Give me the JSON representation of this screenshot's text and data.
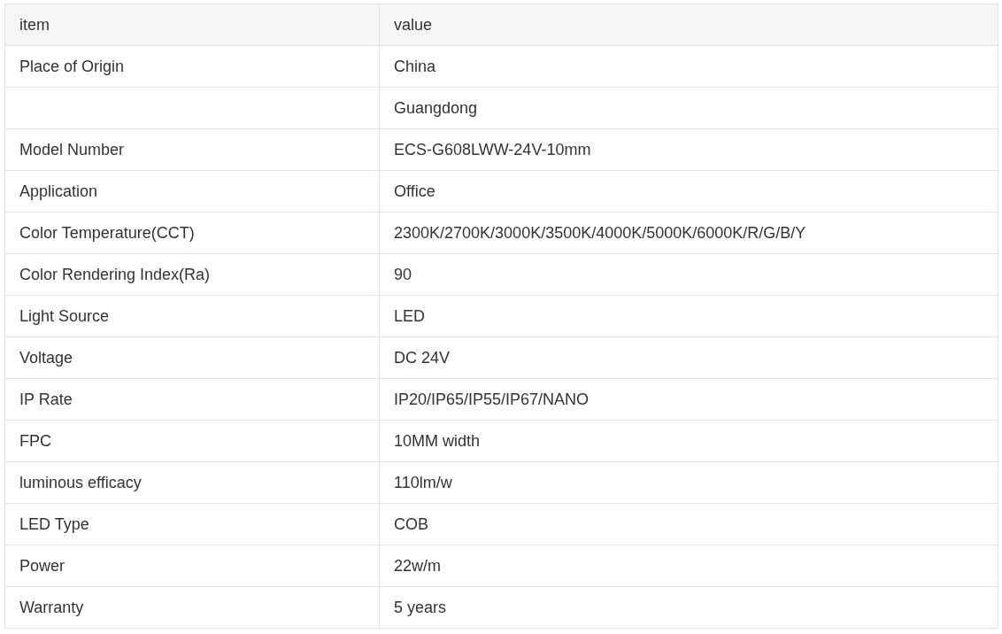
{
  "table": {
    "columns": [
      "item",
      "value"
    ],
    "rows": [
      {
        "item": "Place of Origin",
        "value": "China"
      },
      {
        "item": "",
        "value": "Guangdong"
      },
      {
        "item": "Model Number",
        "value": "ECS-G608LWW-24V-10mm"
      },
      {
        "item": "Application",
        "value": "Office"
      },
      {
        "item": "Color Temperature(CCT)",
        "value": "2300K/2700K/3000K/3500K/4000K/5000K/6000K/R/G/B/Y"
      },
      {
        "item": "Color Rendering Index(Ra)",
        "value": "90"
      },
      {
        "item": "Light Source",
        "value": "LED"
      },
      {
        "item": "Voltage",
        "value": "DC 24V"
      },
      {
        "item": "IP Rate",
        "value": "IP20/IP65/IP55/IP67/NANO"
      },
      {
        "item": "FPC",
        "value": "10MM width"
      },
      {
        "item": "luminous efficacy",
        "value": "110lm/w"
      },
      {
        "item": "LED Type",
        "value": "COB"
      },
      {
        "item": "Power",
        "value": "22w/m"
      },
      {
        "item": "Warranty",
        "value": "5 years"
      }
    ]
  }
}
